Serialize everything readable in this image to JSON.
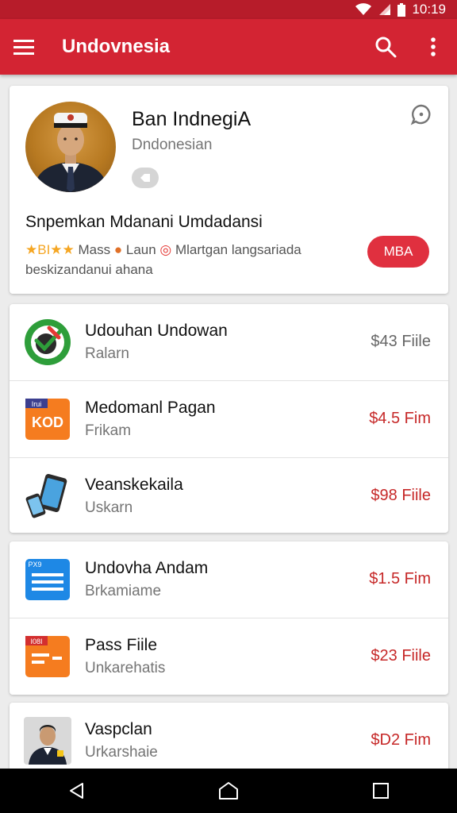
{
  "status": {
    "time": "10:19"
  },
  "appbar": {
    "title": "Undovnesia"
  },
  "profile": {
    "name": "Ban IndnegiA",
    "subtitle": "Dndonesian",
    "headline": "Snpemkan Mdanani Umdadansi",
    "meta_stars": "★BI★★",
    "meta_part1": " Mass ",
    "meta_dot": "●",
    "meta_part2": " Laun ",
    "meta_ring": "◎",
    "meta_part3": " Mlartgan langsariada",
    "meta_line2": "beskizandanui ahana",
    "button_label": "MBA"
  },
  "lists": [
    {
      "items": [
        {
          "title": "Udouhan Undowan",
          "subtitle": "Ralarn",
          "price": "$43 Fiile",
          "price_style": "grey",
          "icon": "check-badge-icon"
        },
        {
          "title": "Medomanl Pagan",
          "subtitle": "Frikam",
          "price": "$4.5 Fim",
          "price_style": "red",
          "icon": "kod-app-icon",
          "icon_text": "KOD",
          "icon_tag": "Irui"
        },
        {
          "title": "Veanskekaila",
          "subtitle": "Uskarn",
          "price": "$98 Fiile",
          "price_style": "red",
          "icon": "devices-icon"
        }
      ]
    },
    {
      "items": [
        {
          "title": "Undovha Andam",
          "subtitle": "Brkamiame",
          "price": "$1.5 Fim",
          "price_style": "red",
          "icon": "document-icon",
          "icon_tag": "PX9"
        },
        {
          "title": "Pass Fiile",
          "subtitle": "Unkarehatis",
          "price": "$23 Fiile",
          "price_style": "red",
          "icon": "pass-file-icon",
          "icon_tag": "I08I"
        }
      ]
    },
    {
      "items": [
        {
          "title": "Vaspclan",
          "subtitle": "Urkarshaie",
          "price": "$D2 Fim",
          "price_style": "red",
          "icon": "person-thumbnail-icon"
        }
      ]
    }
  ],
  "colors": {
    "primary": "#d32433",
    "status": "#b71c2a",
    "accent_red": "#c62828"
  }
}
